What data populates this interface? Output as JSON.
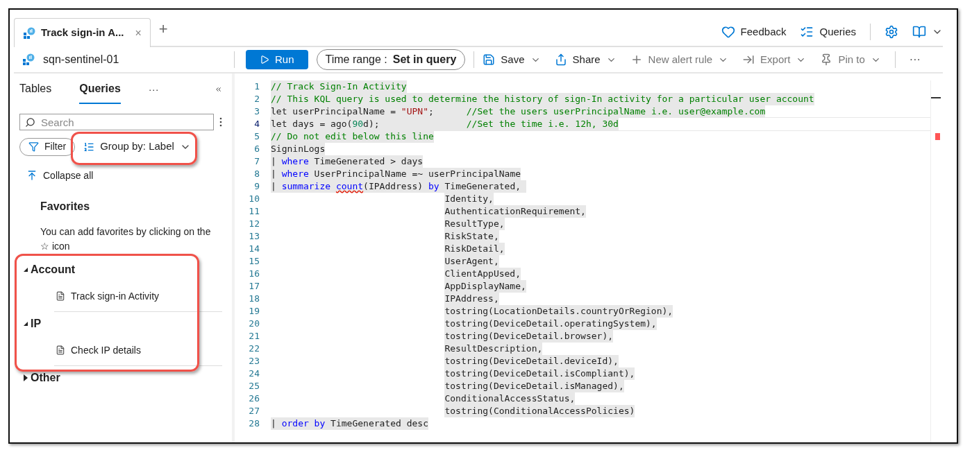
{
  "tab": {
    "title": "Track sign-in A...",
    "close": "×",
    "add": "+"
  },
  "header_actions": [
    {
      "kind": "feedback",
      "label": "Feedback"
    },
    {
      "kind": "queries",
      "label": "Queries"
    }
  ],
  "workspace": "sqn-sentinel-01",
  "toolbar": {
    "run": "Run",
    "time_range": {
      "label": "Time range :",
      "value": "Set in query"
    },
    "actions": [
      {
        "kind": "save",
        "label": "Save",
        "disabled": false
      },
      {
        "kind": "share",
        "label": "Share",
        "disabled": false
      },
      {
        "kind": "alert",
        "label": "New alert rule",
        "disabled": true
      },
      {
        "kind": "export",
        "label": "Export",
        "disabled": true
      },
      {
        "kind": "pin",
        "label": "Pin to",
        "disabled": true
      }
    ],
    "more": "···"
  },
  "sidebar": {
    "tabs": [
      {
        "label": "Tables",
        "selected": false
      },
      {
        "label": "Queries",
        "selected": true
      }
    ],
    "more": "···",
    "search": {
      "placeholder": "Search"
    },
    "filter": "Filter",
    "group_by": "Group by: Label",
    "collapse_all": "Collapse all",
    "favorites": {
      "title": "Favorites",
      "hint": "You can add favorites by clicking on the ☆ icon"
    },
    "groups": [
      {
        "label": "Account",
        "expanded": true,
        "children": [
          {
            "label": "Track sign-in Activity"
          }
        ]
      },
      {
        "label": "IP",
        "expanded": true,
        "children": [
          {
            "label": "Check IP details"
          }
        ]
      },
      {
        "label": "Other",
        "expanded": false
      }
    ]
  },
  "editor": {
    "lines": [
      {
        "number": "1",
        "current": false,
        "continuation": false,
        "tokens": [
          {
            "kind": "comment",
            "text": "// Track Sign-In Activity"
          }
        ]
      },
      {
        "number": "2",
        "current": false,
        "continuation": false,
        "tokens": [
          {
            "kind": "comment",
            "text": "// This KQL query is used to determine the history of sign-In activity for a particular user account"
          }
        ]
      },
      {
        "number": "3",
        "current": false,
        "continuation": false,
        "tokens": [
          {
            "kind": "plain",
            "text": "let userPrincipalName = "
          },
          {
            "kind": "string",
            "text": "\"UPN\""
          },
          {
            "kind": "plain",
            "text": ";      "
          },
          {
            "kind": "comment",
            "text": "//Set the users userPrincipalName i.e. user@example.com"
          }
        ]
      },
      {
        "number": "4",
        "current": true,
        "continuation": false,
        "tokens": [
          {
            "kind": "plain",
            "text": "let days = ago("
          },
          {
            "kind": "number",
            "text": "90"
          },
          {
            "kind": "plain",
            "text": "d);                "
          },
          {
            "kind": "comment",
            "text": "//Set the time i.e. 12h, 30d"
          }
        ]
      },
      {
        "number": "5",
        "current": false,
        "continuation": false,
        "tokens": [
          {
            "kind": "comment",
            "text": "// Do not edit below this line"
          }
        ]
      },
      {
        "number": "6",
        "current": false,
        "continuation": false,
        "tokens": [
          {
            "kind": "plain",
            "text": "SigninLogs"
          }
        ]
      },
      {
        "number": "7",
        "current": false,
        "continuation": false,
        "tokens": [
          {
            "kind": "plain",
            "text": "| "
          },
          {
            "kind": "keyword",
            "text": "where"
          },
          {
            "kind": "plain",
            "text": " TimeGenerated > days"
          }
        ]
      },
      {
        "number": "8",
        "current": false,
        "continuation": false,
        "tokens": [
          {
            "kind": "plain",
            "text": "| "
          },
          {
            "kind": "keyword",
            "text": "where"
          },
          {
            "kind": "plain",
            "text": " UserPrincipalName =~ userPrincipalName"
          }
        ]
      },
      {
        "number": "9",
        "current": false,
        "continuation": false,
        "tokens": [
          {
            "kind": "plain",
            "text": "| "
          },
          {
            "kind": "keyword",
            "text": "summarize "
          },
          {
            "kind": "error",
            "text": "count"
          },
          {
            "kind": "plain",
            "text": "(IPAddress) "
          },
          {
            "kind": "keyword",
            "text": "by"
          },
          {
            "kind": "plain",
            "text": " TimeGenerated, "
          }
        ]
      },
      {
        "number": "10",
        "current": false,
        "continuation": true,
        "tokens": [
          {
            "kind": "plain",
            "text": "Identity,"
          }
        ]
      },
      {
        "number": "11",
        "current": false,
        "continuation": true,
        "tokens": [
          {
            "kind": "plain",
            "text": "AuthenticationRequirement,"
          }
        ]
      },
      {
        "number": "12",
        "current": false,
        "continuation": true,
        "tokens": [
          {
            "kind": "plain",
            "text": "ResultType,"
          }
        ]
      },
      {
        "number": "13",
        "current": false,
        "continuation": true,
        "tokens": [
          {
            "kind": "plain",
            "text": "RiskState,"
          }
        ]
      },
      {
        "number": "14",
        "current": false,
        "continuation": true,
        "tokens": [
          {
            "kind": "plain",
            "text": "RiskDetail,"
          }
        ]
      },
      {
        "number": "15",
        "current": false,
        "continuation": true,
        "tokens": [
          {
            "kind": "plain",
            "text": "UserAgent,"
          }
        ]
      },
      {
        "number": "16",
        "current": false,
        "continuation": true,
        "tokens": [
          {
            "kind": "plain",
            "text": "ClientAppUsed,"
          }
        ]
      },
      {
        "number": "17",
        "current": false,
        "continuation": true,
        "tokens": [
          {
            "kind": "plain",
            "text": "AppDisplayName,"
          }
        ]
      },
      {
        "number": "18",
        "current": false,
        "continuation": true,
        "tokens": [
          {
            "kind": "plain",
            "text": "IPAddress,"
          }
        ]
      },
      {
        "number": "19",
        "current": false,
        "continuation": true,
        "tokens": [
          {
            "kind": "plain",
            "text": "tostring(LocationDetails.countryOrRegion),"
          }
        ]
      },
      {
        "number": "20",
        "current": false,
        "continuation": true,
        "tokens": [
          {
            "kind": "plain",
            "text": "tostring(DeviceDetail.operatingSystem),"
          }
        ]
      },
      {
        "number": "21",
        "current": false,
        "continuation": true,
        "tokens": [
          {
            "kind": "plain",
            "text": "tostring(DeviceDetail.browser),"
          }
        ]
      },
      {
        "number": "22",
        "current": false,
        "continuation": true,
        "tokens": [
          {
            "kind": "plain",
            "text": "ResultDescription,"
          }
        ]
      },
      {
        "number": "23",
        "current": false,
        "continuation": true,
        "tokens": [
          {
            "kind": "plain",
            "text": "tostring(DeviceDetail.deviceId),"
          }
        ]
      },
      {
        "number": "24",
        "current": false,
        "continuation": true,
        "tokens": [
          {
            "kind": "plain",
            "text": "tostring(DeviceDetail.isCompliant),"
          }
        ]
      },
      {
        "number": "25",
        "current": false,
        "continuation": true,
        "tokens": [
          {
            "kind": "plain",
            "text": "tostring(DeviceDetail.isManaged),"
          }
        ]
      },
      {
        "number": "26",
        "current": false,
        "continuation": true,
        "tokens": [
          {
            "kind": "plain",
            "text": "ConditionalAccessStatus,"
          }
        ]
      },
      {
        "number": "27",
        "current": false,
        "continuation": true,
        "tokens": [
          {
            "kind": "plain",
            "text": "tostring(ConditionalAccessPolicies)"
          }
        ]
      },
      {
        "number": "28",
        "current": false,
        "continuation": false,
        "tokens": [
          {
            "kind": "plain",
            "text": "| "
          },
          {
            "kind": "keyword",
            "text": "order by"
          },
          {
            "kind": "plain",
            "text": " TimeGenerated desc"
          }
        ]
      }
    ]
  }
}
